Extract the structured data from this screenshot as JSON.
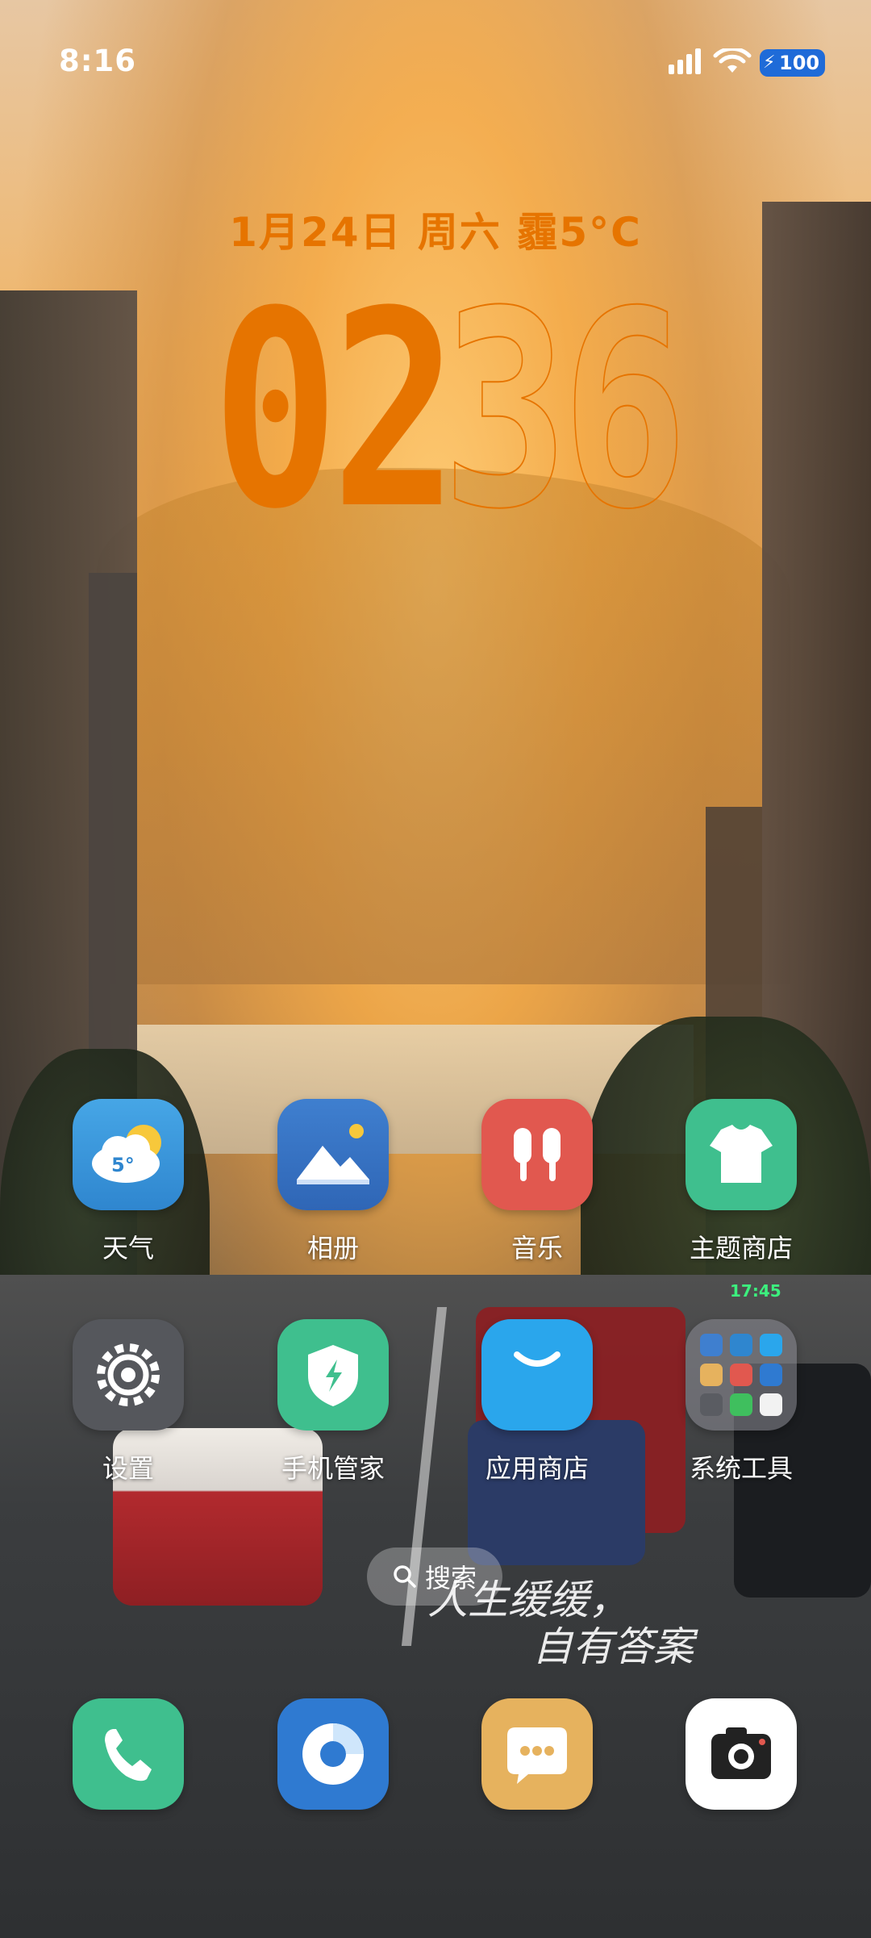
{
  "status_bar": {
    "time": "8:16",
    "battery": "100",
    "signal_icon": "cellular-signal-icon",
    "wifi_icon": "wifi-icon"
  },
  "widget": {
    "date": "1月24日 周六 霾5°C",
    "hours": "02",
    "minutes": "36",
    "accent_color": "#e67400"
  },
  "apps": {
    "weather": {
      "label": "天气",
      "temp": "5°"
    },
    "gallery": {
      "label": "相册"
    },
    "music": {
      "label": "音乐"
    },
    "theme_store": {
      "label": "主题商店"
    },
    "settings": {
      "label": "设置"
    },
    "phone_manager": {
      "label": "手机管家"
    },
    "app_store": {
      "label": "应用商店"
    },
    "system_tools": {
      "label": "系统工具"
    }
  },
  "search": {
    "label": "搜索"
  },
  "wallpaper_text": {
    "line1": "人生缓缓，",
    "line2": "自有答案"
  },
  "wallpaper_clock": "17:45",
  "dock": {
    "phone": "phone-icon",
    "browser": "browser-icon",
    "messages": "messages-icon",
    "camera": "camera-icon"
  }
}
